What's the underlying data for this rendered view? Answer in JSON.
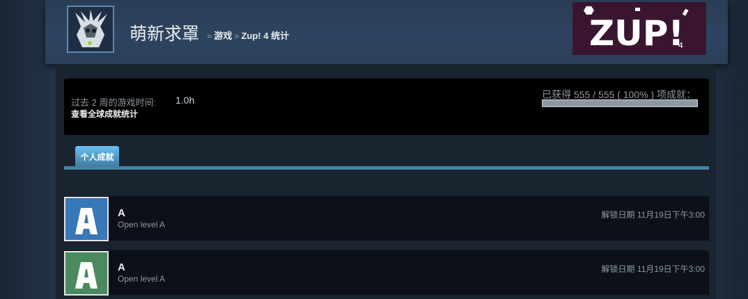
{
  "profile": {
    "persona_name": "萌新求罩"
  },
  "breadcrumb": {
    "separator": "»",
    "games": "游戏",
    "stats": "Zup! 4 统计"
  },
  "game_logo_text": "ZUP!",
  "game_logo_sub": "4",
  "summary": {
    "playtime_label": "过去 2 周的游戏时间:",
    "playtime_value": "1.0h",
    "global_stats_link": "查看全球成就统计",
    "earned_label": "已获得 555 / 555 ( 100% ) 项成就：",
    "earned_fraction": 1.0
  },
  "tabs": [
    {
      "label": "个人成就"
    }
  ],
  "achievements": [
    {
      "title": "A",
      "description": "Open level A",
      "unlock": "解锁日期 11月19日下午3:00",
      "icon_color": "#3878b8",
      "icon_letter": "A"
    },
    {
      "title": "A",
      "description": "Open level A",
      "unlock": "解锁日期 11月19日下午3:00",
      "icon_color": "#4a8a5e",
      "icon_letter": "A"
    }
  ],
  "colors": {
    "accent": "#67c1f5",
    "tab_line": "#4a7fa6",
    "background": "#1b2838"
  }
}
